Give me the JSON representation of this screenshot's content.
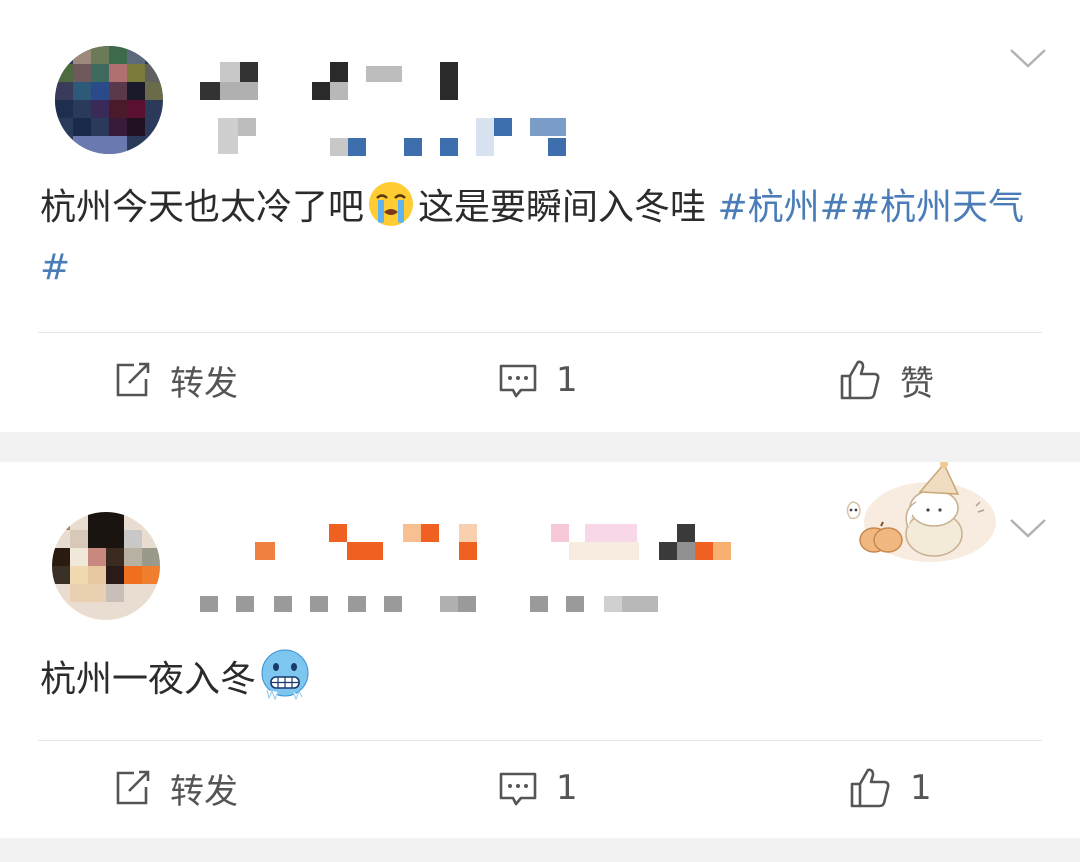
{
  "posts": [
    {
      "content_prefix": "杭州今天也太冷了吧",
      "emoji_1": "loudly-crying-emoji",
      "content_mid": "这是要瞬间入冬哇 ",
      "hashtag_1": "#杭州#",
      "hashtag_2": "#杭州天气#",
      "actions": {
        "repost_label": "转发",
        "comment_count": "1",
        "like_label": "赞"
      }
    },
    {
      "content": "杭州一夜入冬",
      "emoji_1": "cold-face-emoji",
      "actions": {
        "repost_label": "转发",
        "comment_count": "1",
        "like_count": "1"
      }
    }
  ],
  "colors": {
    "hashtag": "#4a7db8",
    "text": "#2b2b2b",
    "icon": "#555555",
    "separator": "#f2f2f2"
  }
}
